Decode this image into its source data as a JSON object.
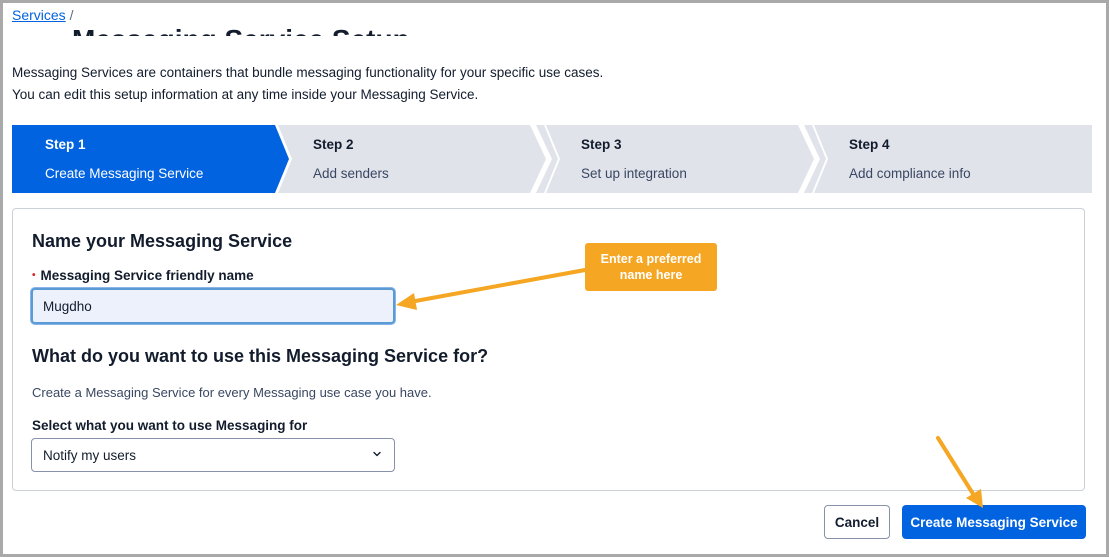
{
  "breadcrumb": {
    "link": "Services",
    "separator": "/"
  },
  "page": {
    "title": "Messaging Service Setup",
    "intro_line1": "Messaging Services are containers that bundle messaging functionality for your specific use cases.",
    "intro_line2": "You can edit this setup information at any time inside your Messaging Service."
  },
  "stepper": {
    "steps": [
      {
        "num": "Step 1",
        "label": "Create Messaging Service",
        "active": true
      },
      {
        "num": "Step 2",
        "label": "Add senders",
        "active": false
      },
      {
        "num": "Step 3",
        "label": "Set up integration",
        "active": false
      },
      {
        "num": "Step 4",
        "label": "Add compliance info",
        "active": false
      }
    ]
  },
  "form": {
    "name_heading": "Name your Messaging Service",
    "name_label": "Messaging Service friendly name",
    "name_value": "Mugdho",
    "use_heading": "What do you want to use this Messaging Service for?",
    "use_help": "Create a Messaging Service for every Messaging use case you have.",
    "select_label": "Select what you want to use Messaging for",
    "select_value": "Notify my users"
  },
  "actions": {
    "cancel_label": "Cancel",
    "create_label": "Create Messaging Service"
  },
  "annotation": {
    "callout_line1": "Enter a preferred",
    "callout_line2": "name here",
    "color": "#f5a623"
  },
  "colors": {
    "primary": "#0263e0",
    "step_inactive": "#e1e3ea",
    "input_focus_bg": "#edf1fb"
  }
}
